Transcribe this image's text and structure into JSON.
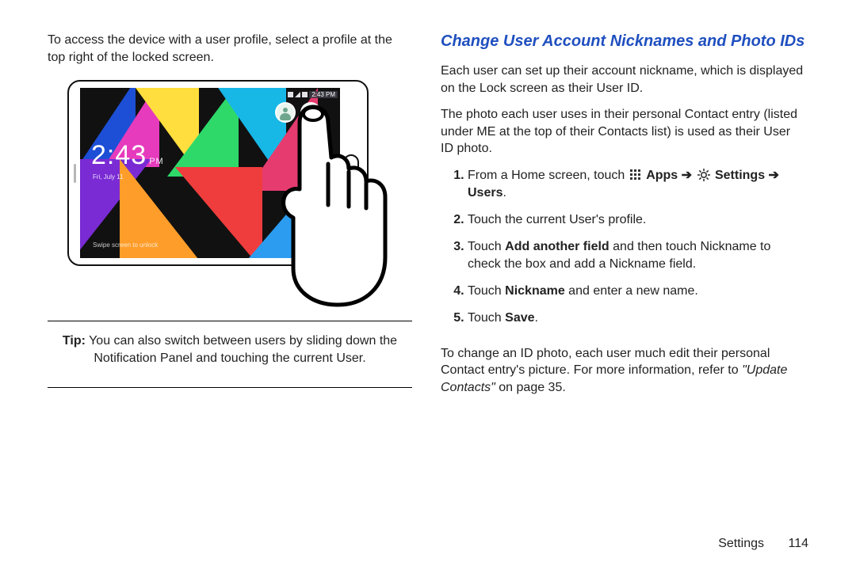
{
  "left": {
    "intro": "To access the device with a user profile, select a profile at the top right of the locked screen.",
    "lock": {
      "statusbar_time": "2:43 PM",
      "time": "2:43",
      "time_period": "PM",
      "date": "Fri, July 11",
      "swipe": "Swipe screen to unlock"
    },
    "tip_label": "Tip:",
    "tip": " You can also switch between users by sliding down the Notification Panel and touching the current User."
  },
  "right": {
    "heading": "Change User Account Nicknames and Photo IDs",
    "para1": "Each user can set up their account nickname, which is displayed on the Lock screen as their User ID.",
    "para2": "The photo each user uses in their personal Contact entry (listed under ME at the top of their Contacts list) is used as their User ID photo.",
    "steps": {
      "s1_a": "From a Home screen, touch ",
      "s1_apps": "Apps",
      "s1_arrow": " ➔ ",
      "s1_settings": "Settings",
      "s1_arrow2": " ➔ ",
      "s1_users": "Users",
      "s1_end": ".",
      "s2": "Touch the current User's profile.",
      "s3_a": "Touch ",
      "s3_b": "Add another field",
      "s3_c": " and then touch Nickname to check the box and add a Nickname field.",
      "s4_a": "Touch ",
      "s4_b": "Nickname",
      "s4_c": " and enter a new name.",
      "s5_a": "Touch ",
      "s5_b": "Save",
      "s5_c": "."
    },
    "para3_a": "To change an ID photo, each user much edit their personal Contact entry's picture. For more information, refer to ",
    "para3_ref": "\"Update Contacts\"",
    "para3_b": " on page 35."
  },
  "footer": {
    "section": "Settings",
    "page": "114"
  }
}
